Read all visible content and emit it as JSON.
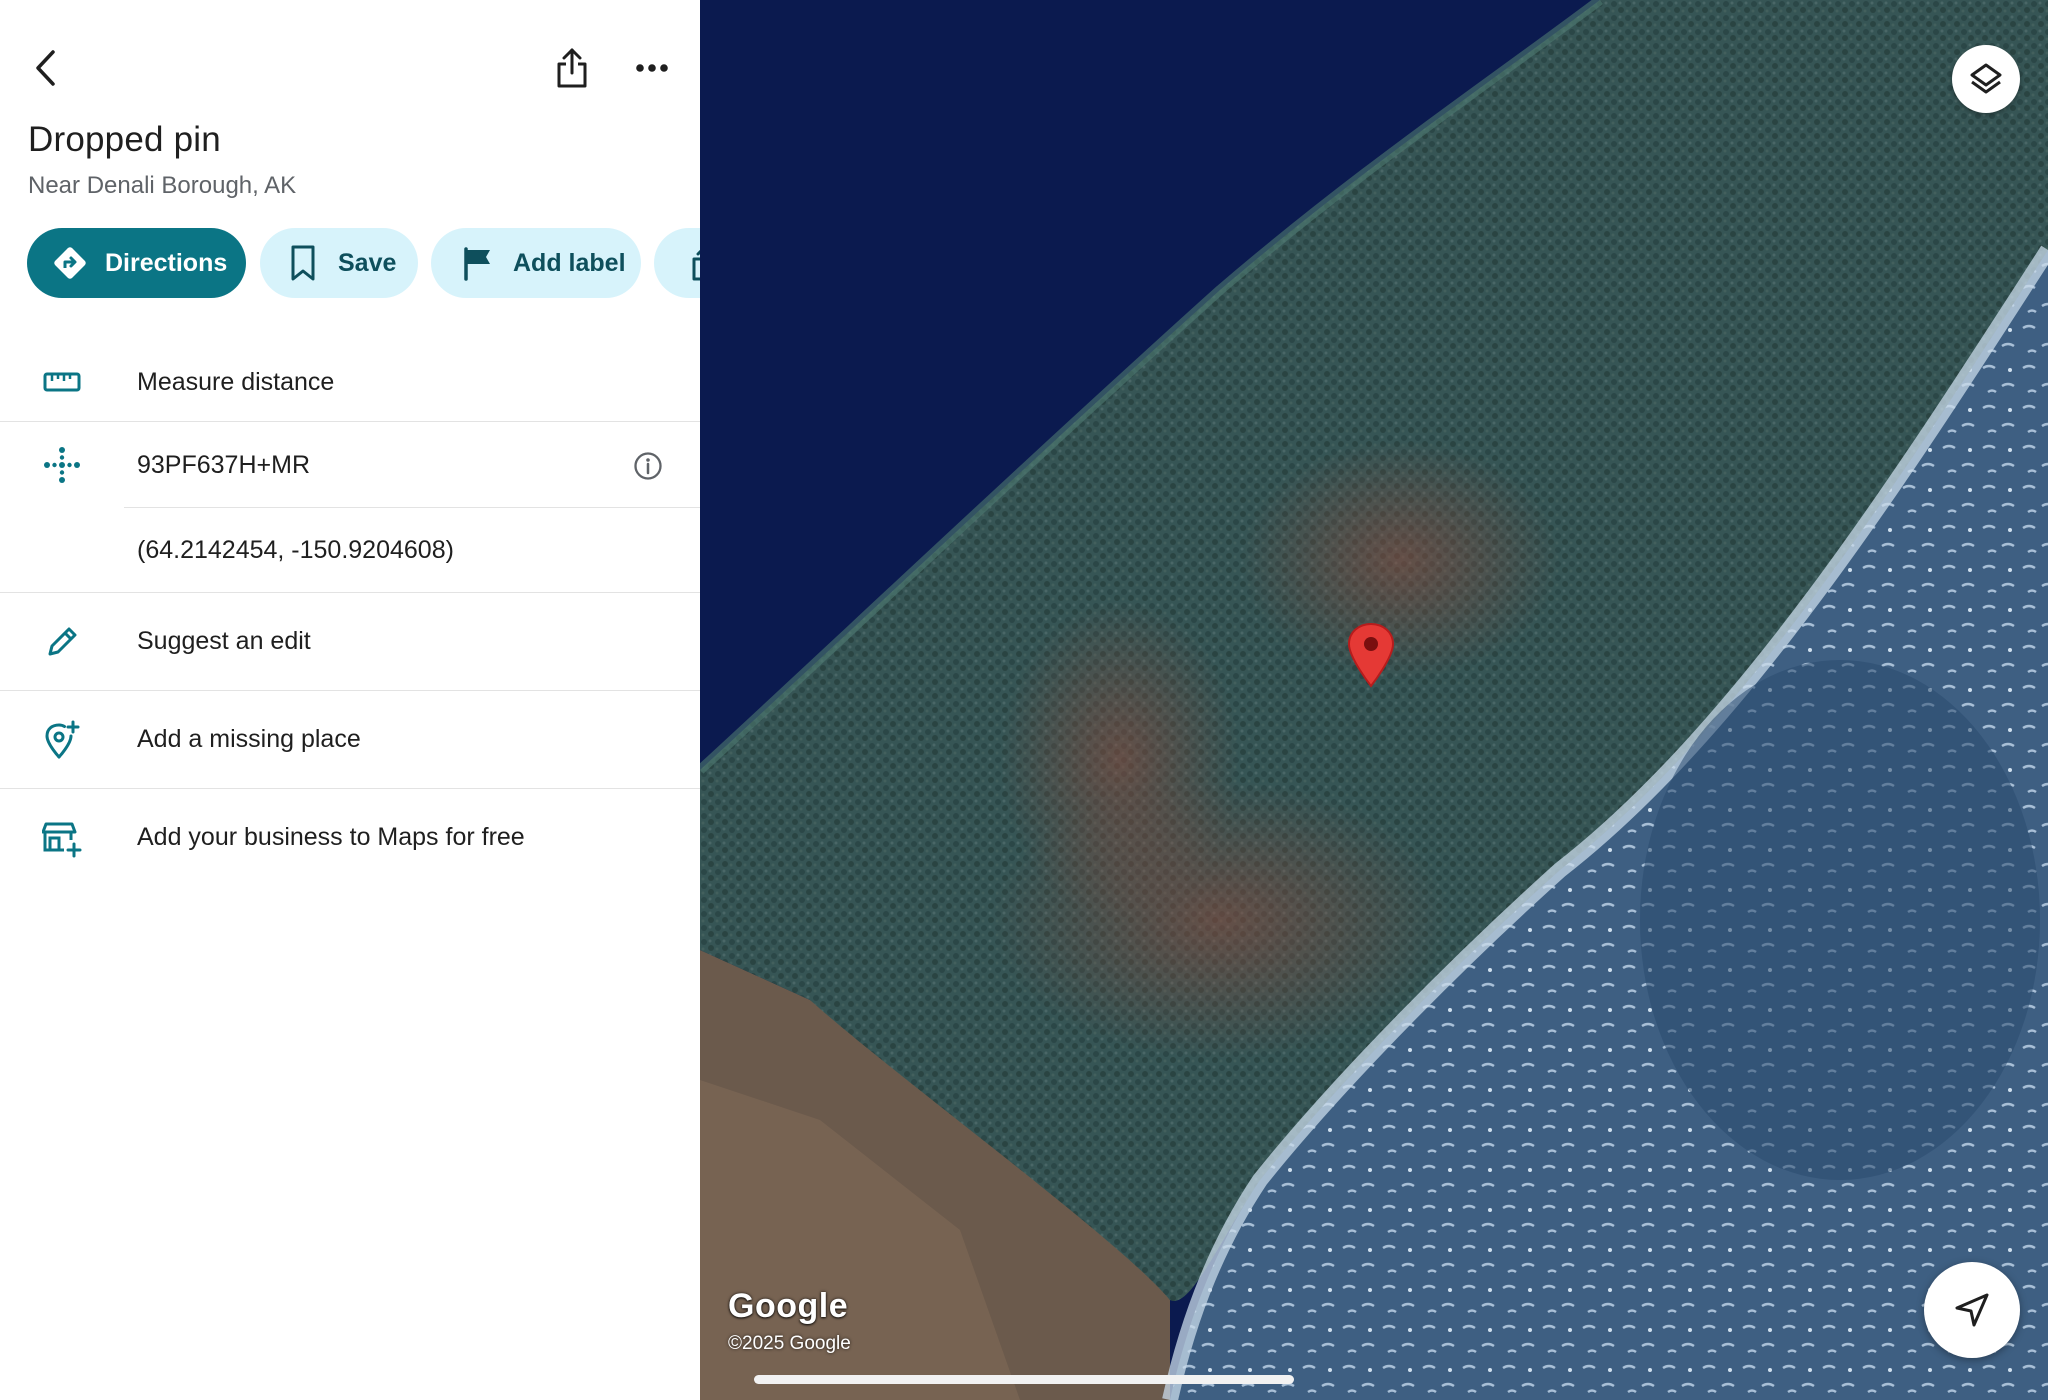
{
  "place": {
    "title": "Dropped pin",
    "subtitle": "Near Denali Borough, AK"
  },
  "header": {
    "back_icon": "chevron-left-icon",
    "share_icon": "share-icon",
    "more_icon": "more-horizontal-icon"
  },
  "actions": {
    "directions": "Directions",
    "save": "Save",
    "add_label": "Add label"
  },
  "rows": {
    "measure": "Measure distance",
    "plus_code": "93PF637H+MR",
    "coordinates": "(64.2142454, -150.9204608)",
    "suggest_edit": "Suggest an edit",
    "add_missing_place": "Add a missing place",
    "add_business": "Add your business to Maps for free"
  },
  "map": {
    "logo": "Google",
    "copyright": "©2025 Google",
    "layers_icon": "layers-icon",
    "location_icon": "navigation-arrow-icon",
    "pin_icon": "map-pin-icon"
  },
  "colors": {
    "accent": "#0b7585",
    "chip_bg": "#d7f3fb",
    "chip_text": "#0e4f5c",
    "pin": "#e53935"
  }
}
